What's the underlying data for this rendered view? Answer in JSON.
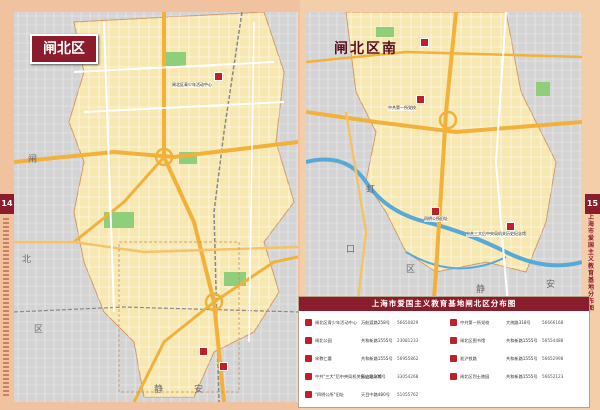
{
  "left_page": {
    "district": "闸北区",
    "page_number": "14"
  },
  "right_page": {
    "district": "闸北区南",
    "page_number": "15",
    "side_text": "上海市爱国主义教育基地分布图"
  },
  "legend": {
    "title": "上海市爱国主义教育基地闸北区分布图",
    "rows": [
      {
        "name": "闸北区青少年活动中心",
        "addr": "万航渡路258号",
        "phone": "56650829"
      },
      {
        "name": "闸北公园",
        "addr": "共和新路1555号",
        "phone": "23081233"
      },
      {
        "name": "宋教仁墓",
        "addr": "共和新路1555号",
        "phone": "56955862"
      },
      {
        "name": "中共\"三大\"后中央局机关历史纪念馆",
        "addr": "象山路100号",
        "phone": "33054268"
      },
      {
        "name": "\"四明公所\"旧址",
        "addr": "天目中路480号",
        "phone": "51055762"
      },
      {
        "name": "中共第一所党校",
        "addr": "大统路318号",
        "phone": "56666168"
      },
      {
        "name": "闸北区图书馆",
        "addr": "共和新路1555号",
        "phone": "56554488"
      },
      {
        "name": "淞沪铁路",
        "addr": "共和新路1555号",
        "phone": "56652998"
      },
      {
        "name": "闸北区烈士陵园",
        "addr": "共和新路1555号",
        "phone": "56652123"
      }
    ]
  },
  "map_labels": {
    "left_area": "闸",
    "left_area2": "北",
    "left_area3": "区",
    "left_area4": "静",
    "left_area5": "安",
    "right_area": "虹",
    "right_area2": "口",
    "right_area3": "区",
    "right_area4": "静",
    "right_area5": "安"
  },
  "pins": [
    {
      "label": "闸北区青少年活动中心"
    },
    {
      "label": "宋教仁墓"
    },
    {
      "label": "闸北公园"
    },
    {
      "label": "中共第一所党校"
    },
    {
      "label": "四明公所旧址"
    },
    {
      "label": "中共三大后中央局机关历史纪念馆"
    }
  ],
  "colors": {
    "accent": "#8b1c2c",
    "district_fill": "#f7e7b0",
    "road_major": "#f2b13a",
    "water": "#58a9d6",
    "green": "#8fce7a"
  }
}
